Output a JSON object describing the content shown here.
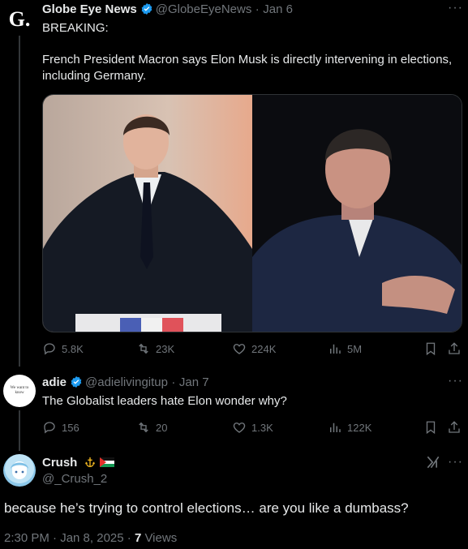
{
  "tweet1": {
    "avatar_letter": "G.",
    "name": "Globe Eye News",
    "handle": "@GlobeEyeNews",
    "separator": "·",
    "date": "Jan 6",
    "line1": "BREAKING:",
    "line2": "French President Macron says Elon Musk is directly intervening in elections,",
    "line3": "including Germany.",
    "stats": {
      "replies": "5.8K",
      "retweets": "23K",
      "likes": "224K",
      "views": "5M"
    }
  },
  "tweet2": {
    "avatar_text": "We want to know",
    "name": "adie",
    "handle": "@adielivingitup",
    "separator": "·",
    "date": "Jan 7",
    "text": "The Globalist leaders hate Elon wonder why?",
    "stats": {
      "replies": "156",
      "retweets": "20",
      "likes": "1.3K",
      "views": "122K"
    }
  },
  "main": {
    "name": "Crush",
    "handle": "@_Crush_2",
    "text": "because he’s trying to control elections… are you like a dumbass?",
    "time": "2:30 PM · Jan 8, 2025 ·",
    "views_count": "7",
    "views_label": "Views"
  },
  "colors": {
    "background": "#000000",
    "text": "#e7e9ea",
    "muted": "#71767b",
    "verified": "#1d9bf0"
  }
}
